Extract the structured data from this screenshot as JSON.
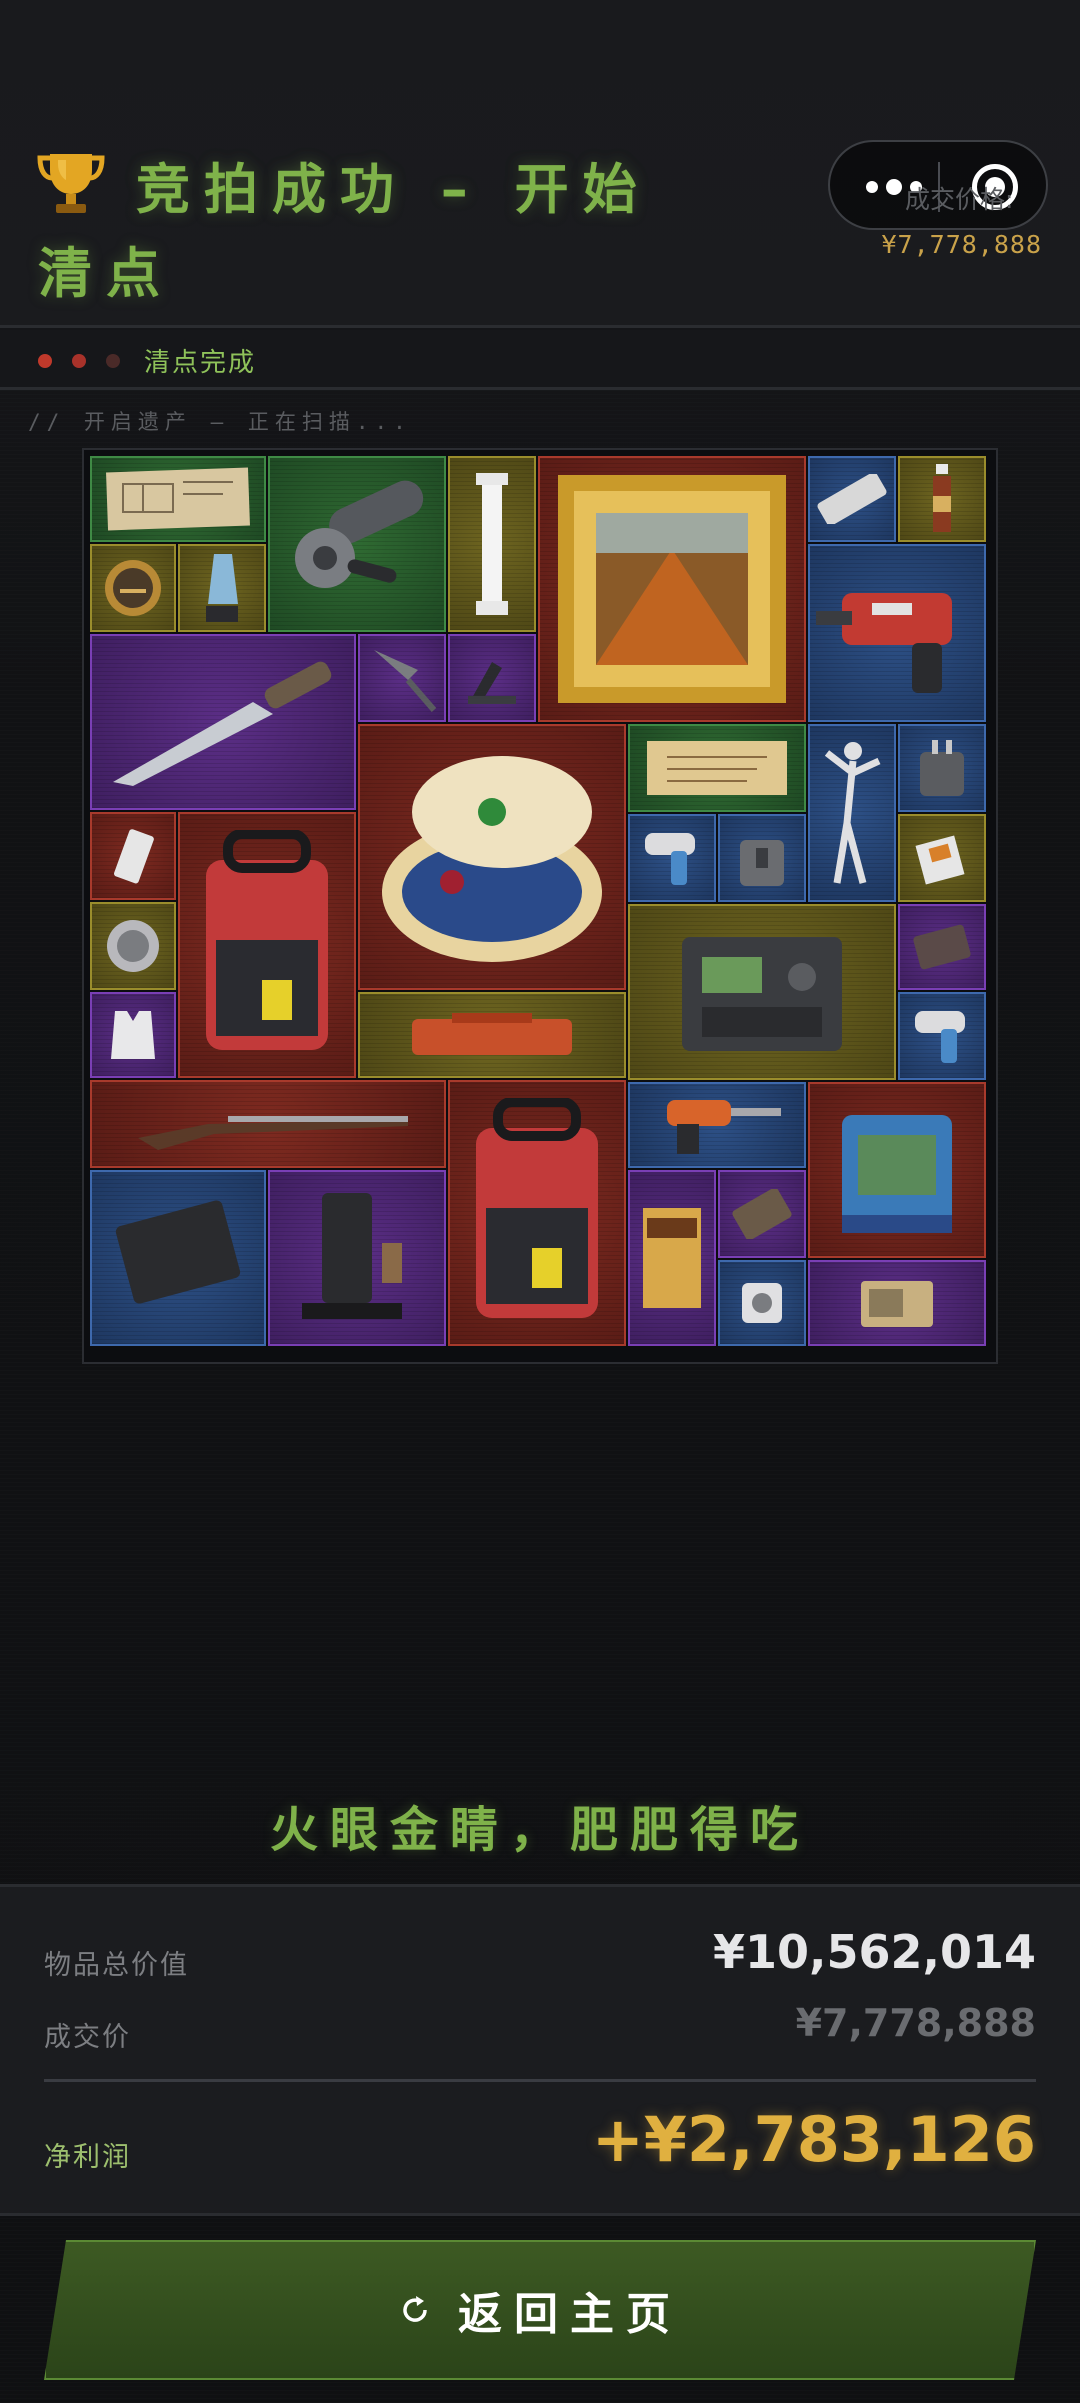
{
  "header": {
    "title": "竞拍成功 – 开始清点",
    "deal_label": "成交价格:",
    "deal_price": "¥7,778,888"
  },
  "status": {
    "text": "清点完成",
    "dots": [
      "#c0392b",
      "#a8322a",
      "#4a2a28"
    ]
  },
  "scan_text": "// 开启遗产 – 正在扫描...",
  "inventory": {
    "items": [
      {
        "name": "blueprint-map",
        "rarity": "green"
      },
      {
        "name": "angle-grinder",
        "rarity": "green"
      },
      {
        "name": "marble-column",
        "rarity": "yellow"
      },
      {
        "name": "framed-painting",
        "rarity": "red"
      },
      {
        "name": "remote-control",
        "rarity": "blue"
      },
      {
        "name": "drink-bottle",
        "rarity": "yellow"
      },
      {
        "name": "pocket-watch",
        "rarity": "yellow"
      },
      {
        "name": "crystal-trophy",
        "rarity": "yellow"
      },
      {
        "name": "rotary-hammer-drill",
        "rarity": "blue"
      },
      {
        "name": "combat-knife",
        "rarity": "purple"
      },
      {
        "name": "spearhead",
        "rarity": "purple"
      },
      {
        "name": "phone-stand",
        "rarity": "purple"
      },
      {
        "name": "jeweled-egg",
        "rarity": "red"
      },
      {
        "name": "old-scroll",
        "rarity": "green"
      },
      {
        "name": "ballerina-statue",
        "rarity": "blue"
      },
      {
        "name": "power-adapter",
        "rarity": "blue"
      },
      {
        "name": "usb-drive",
        "rarity": "red"
      },
      {
        "name": "aed-defibrillator",
        "rarity": "red"
      },
      {
        "name": "thermometer-gun",
        "rarity": "blue"
      },
      {
        "name": "travel-adapter",
        "rarity": "blue"
      },
      {
        "name": "cigarette-pack",
        "rarity": "yellow"
      },
      {
        "name": "medal-emblem",
        "rarity": "yellow"
      },
      {
        "name": "field-radio-station",
        "rarity": "yellow"
      },
      {
        "name": "cassette-tape",
        "rarity": "purple"
      },
      {
        "name": "body-armor-vest",
        "rarity": "purple"
      },
      {
        "name": "tool-case",
        "rarity": "yellow"
      },
      {
        "name": "ir-thermometer",
        "rarity": "blue"
      },
      {
        "name": "flintlock-musket",
        "rarity": "red"
      },
      {
        "name": "aed-defibrillator-2",
        "rarity": "red"
      },
      {
        "name": "cordless-drill",
        "rarity": "blue"
      },
      {
        "name": "engine-machine",
        "rarity": "red"
      },
      {
        "name": "tablet-device",
        "rarity": "blue"
      },
      {
        "name": "coffee-machine",
        "rarity": "purple"
      },
      {
        "name": "black-tide-book",
        "rarity": "purple"
      },
      {
        "name": "cassette-tape-2",
        "rarity": "purple"
      },
      {
        "name": "hard-drive",
        "rarity": "blue"
      },
      {
        "name": "vintage-radio",
        "rarity": "purple"
      }
    ]
  },
  "slogan": "火眼金睛，肥肥得吃",
  "summary": {
    "total_label": "物品总价值",
    "total_value": "¥10,562,014",
    "deal_label": "成交价",
    "deal_value": "¥7,778,888",
    "profit_label": "净利润",
    "profit_value": "+¥2,783,126"
  },
  "button": {
    "label": "返回主页",
    "icon": "refresh-icon"
  },
  "colors": {
    "accent_green": "#7fb24a",
    "gold": "#e0b040",
    "background": "#111214"
  }
}
